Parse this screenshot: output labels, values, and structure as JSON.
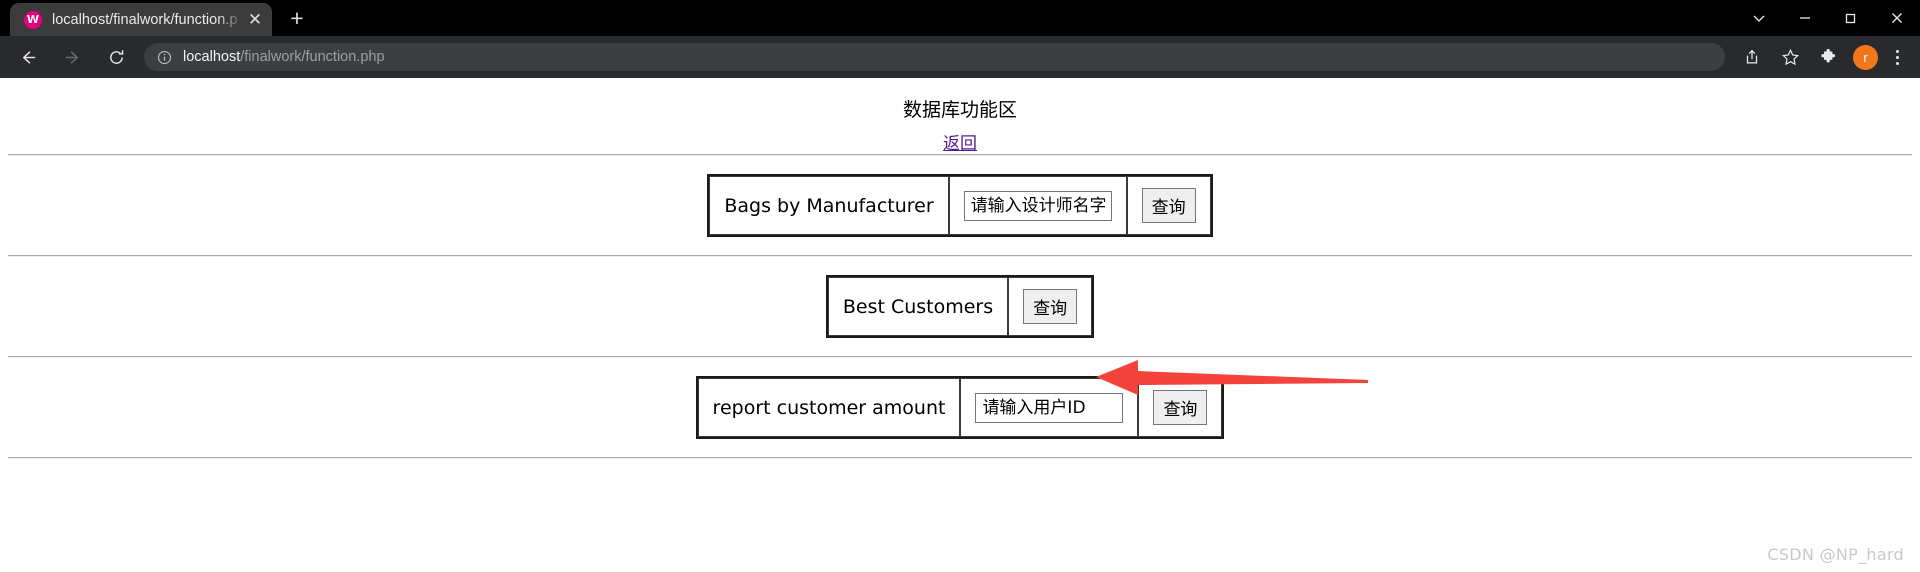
{
  "browser": {
    "tab": {
      "title": "localhost/finalwork/function.p",
      "favicon_name": "wamp-favicon",
      "favicon_letter": "W",
      "favicon_color": "#e6007e",
      "close_label": "✕"
    },
    "new_tab_label": "+",
    "window_controls": [
      {
        "name": "chevron-down-button",
        "label": "⌄"
      },
      {
        "name": "minimize-button",
        "label": "–"
      },
      {
        "name": "maximize-button",
        "label": "❐"
      },
      {
        "name": "close-window-button",
        "label": "✕"
      }
    ],
    "toolbar": {
      "back_label": "←",
      "forward_label": "→",
      "reload_label": "⟳",
      "site_info_label": "ⓘ",
      "url_host": "localhost",
      "url_path": "/finalwork/function.php",
      "url_full": "localhost/finalwork/function.php",
      "share_label": "share-icon",
      "bookmark_label": "☆",
      "extensions_label": "extensions-icon",
      "profile_letter": "r",
      "profile_color": "#f2761b",
      "menu_label": "⋮"
    }
  },
  "page": {
    "title": "数据库功能区",
    "back_link": "返回",
    "rows": [
      {
        "label": "Bags by Manufacturer",
        "has_input": true,
        "input_placeholder": "请输入设计师名字",
        "input_value": "",
        "button_label": "查询"
      },
      {
        "label": "Best Customers",
        "has_input": false,
        "input_placeholder": "",
        "input_value": "",
        "button_label": "查询"
      },
      {
        "label": "report customer amount",
        "has_input": true,
        "input_placeholder": "请输入用户ID",
        "input_value": "",
        "button_label": "查询"
      }
    ],
    "annotation": {
      "name": "red-arrow-annotation",
      "color": "#f4433c",
      "points_to": "Best Customers 查询"
    },
    "watermark": "CSDN @NP_hard"
  }
}
